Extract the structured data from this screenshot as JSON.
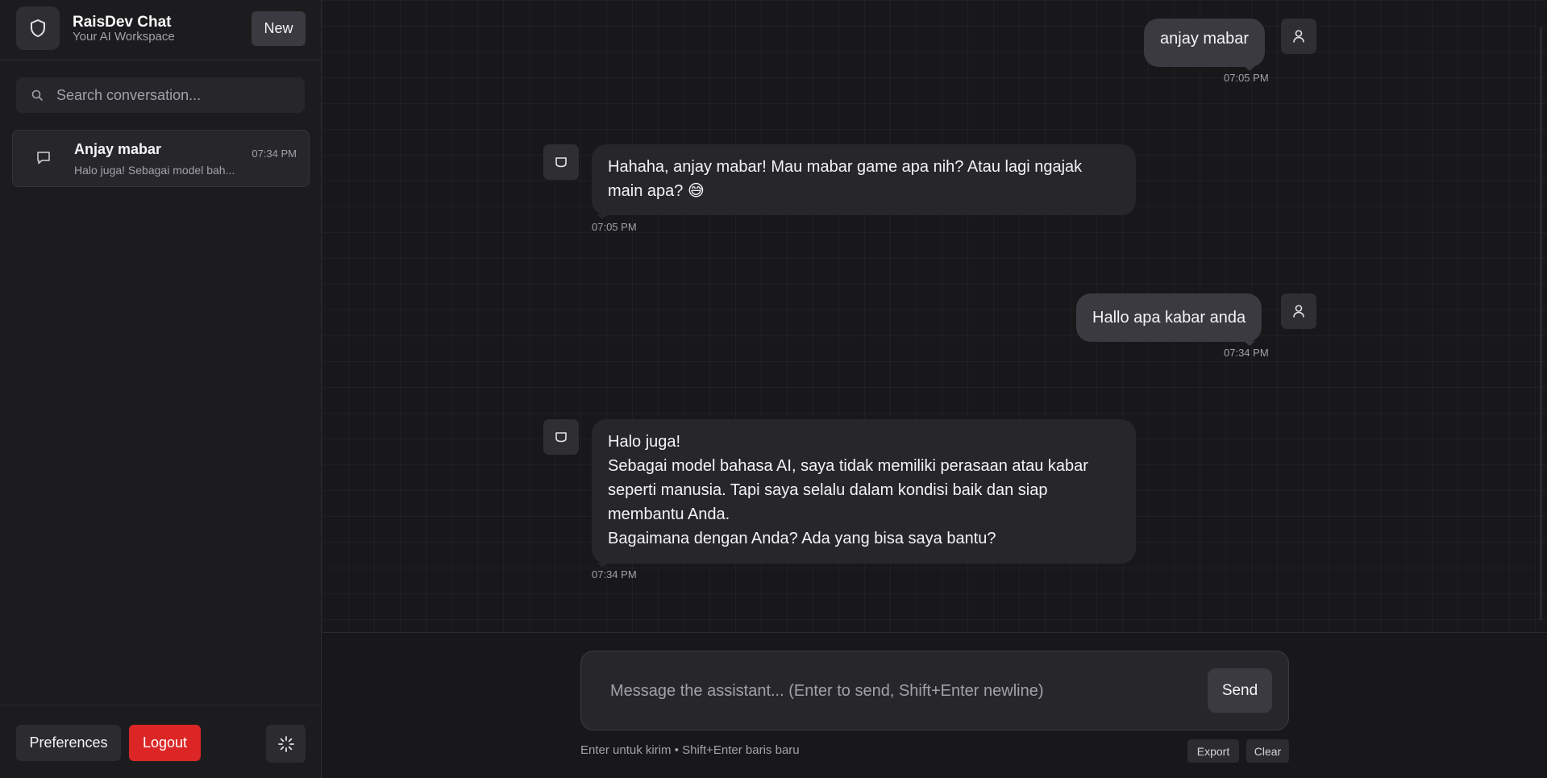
{
  "app": {
    "title": "RaisDev Chat",
    "subtitle": "Your AI Workspace",
    "new_label": "New"
  },
  "search": {
    "placeholder": "Search conversation..."
  },
  "conversations": [
    {
      "title": "Anjay mabar",
      "preview": "Halo juga! Sebagai model bah...",
      "time": "07:34 PM"
    }
  ],
  "footer": {
    "preferences_label": "Preferences",
    "logout_label": "Logout"
  },
  "messages": [
    {
      "role": "user",
      "text": "anjay mabar",
      "time": "07:05 PM"
    },
    {
      "role": "assistant",
      "text": "Hahaha, anjay mabar! Mau mabar game apa nih? Atau lagi ngajak main apa? 😅",
      "time": "07:05 PM"
    },
    {
      "role": "user",
      "text": "Hallo apa kabar anda",
      "time": "07:34 PM"
    },
    {
      "role": "assistant",
      "lines": [
        "Halo juga!",
        "Sebagai model bahasa AI, saya tidak memiliki perasaan atau kabar seperti manusia. Tapi saya selalu dalam kondisi baik dan siap membantu Anda.",
        "Bagaimana dengan Anda? Ada yang bisa saya bantu?"
      ],
      "time": "07:34 PM"
    }
  ],
  "composer": {
    "placeholder": "Message the assistant... (Enter to send, Shift+Enter newline)",
    "send_label": "Send",
    "hint": "Enter untuk kirim • Shift+Enter baris baru",
    "export_label": "Export",
    "clear_label": "Clear"
  },
  "colors": {
    "background": "#18181b",
    "sidebar": "#1c1c1f",
    "bubble_assistant": "#27272b",
    "bubble_user": "#3a3a40",
    "logout": "#dc2626"
  }
}
